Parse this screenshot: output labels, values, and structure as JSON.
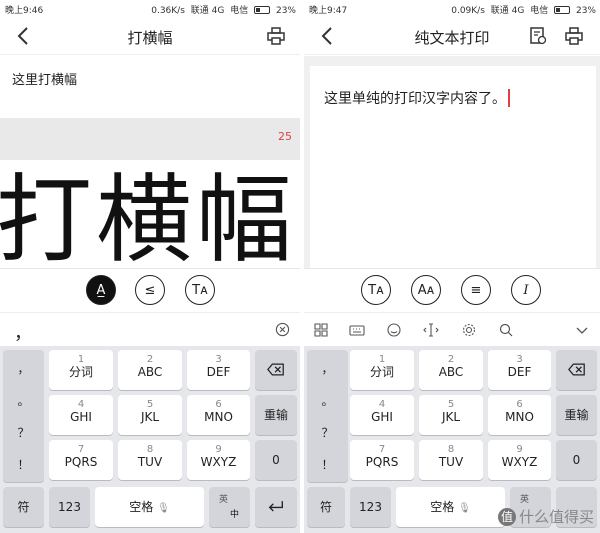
{
  "left": {
    "status": {
      "time": "晚上9:46",
      "speed": "0.36K/s",
      "carrier1": "联通 4G",
      "carrier2": "电信",
      "battery": "23%"
    },
    "title": "打横幅",
    "input_text": "这里打横幅",
    "char_count": "25",
    "banner_preview": "打横幅",
    "candidate": "，",
    "keyboard": {
      "punct": [
        "，",
        "。",
        "？",
        "！"
      ],
      "rows": [
        [
          {
            "n": "1",
            "l": "分词"
          },
          {
            "n": "2",
            "l": "ABC"
          },
          {
            "n": "3",
            "l": "DEF"
          }
        ],
        [
          {
            "n": "4",
            "l": "GHI"
          },
          {
            "n": "5",
            "l": "JKL"
          },
          {
            "n": "6",
            "l": "MNO"
          }
        ],
        [
          {
            "n": "7",
            "l": "PQRS"
          },
          {
            "n": "8",
            "l": "TUV"
          },
          {
            "n": "9",
            "l": "WXYZ"
          }
        ]
      ],
      "reenter": "重输",
      "zero": "0",
      "symbol": "符",
      "num_mode": "123",
      "space": "空格",
      "lang_top": "英",
      "lang_bottom": "中"
    }
  },
  "right": {
    "status": {
      "time": "晚上9:47",
      "speed": "0.09K/s",
      "carrier1": "联通 4G",
      "carrier2": "电信",
      "battery": "23%"
    },
    "title": "纯文本打印",
    "content_text": "这里单纯的打印汉字内容了。",
    "keyboard": {
      "punct": [
        "，",
        "。",
        "？",
        "！"
      ],
      "rows": [
        [
          {
            "n": "1",
            "l": "分词"
          },
          {
            "n": "2",
            "l": "ABC"
          },
          {
            "n": "3",
            "l": "DEF"
          }
        ],
        [
          {
            "n": "4",
            "l": "GHI"
          },
          {
            "n": "5",
            "l": "JKL"
          },
          {
            "n": "6",
            "l": "MNO"
          }
        ],
        [
          {
            "n": "7",
            "l": "PQRS"
          },
          {
            "n": "8",
            "l": "TUV"
          },
          {
            "n": "9",
            "l": "WXYZ"
          }
        ]
      ],
      "reenter": "重输",
      "zero": "0",
      "symbol": "符",
      "num_mode": "123",
      "space": "空格",
      "lang_top": "英"
    }
  },
  "watermark": {
    "badge": "值",
    "text": "什么值得买"
  },
  "colors": {
    "accent_red": "#e04040",
    "keyboard_bg": "#e6e7ea"
  },
  "icons": [
    "back-icon",
    "printer-icon",
    "doc-settings-icon",
    "text-format-icon",
    "font-size-icon",
    "align-icon",
    "italic-icon",
    "clear-icon",
    "grid-icon",
    "keyboard-icon",
    "emoji-icon",
    "cursor-icon",
    "settings-icon",
    "search-icon",
    "chevron-down-icon",
    "backspace-icon",
    "enter-icon",
    "mic-icon"
  ]
}
